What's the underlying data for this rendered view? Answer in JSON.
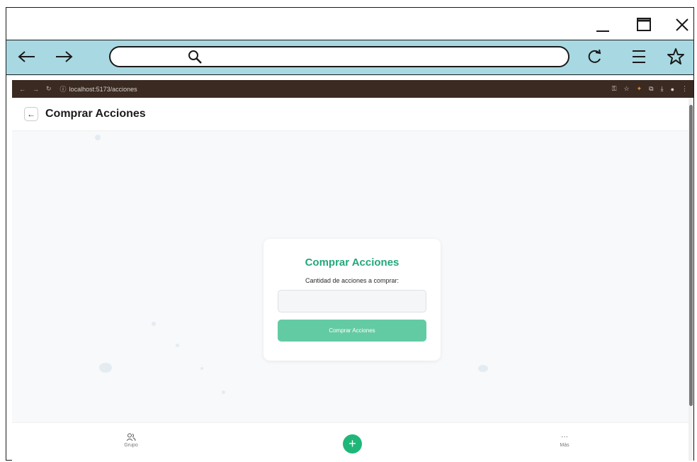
{
  "browser": {
    "url": "localhost:5173/acciones"
  },
  "header": {
    "title": "Comprar Acciones"
  },
  "form": {
    "title": "Comprar Acciones",
    "quantity_label": "Cantidad de acciones a comprar:",
    "quantity_value": "",
    "quantity_placeholder": "",
    "submit_label": "Comprar Acciones"
  },
  "bottom_nav": {
    "group_label": "Grupo",
    "add_symbol": "+",
    "more_symbol": "···",
    "more_label": "Más"
  },
  "colors": {
    "accent": "#23a77a",
    "button": "#63cba4",
    "fab": "#1fb779",
    "sketch_navbar": "#a8d8e2"
  },
  "icons": [
    "minimize-icon",
    "maximize-icon",
    "close-icon",
    "back-arrow-icon",
    "forward-arrow-icon",
    "search-icon",
    "reload-icon",
    "menu-icon",
    "star-icon",
    "users-icon",
    "plus-icon",
    "more-icon"
  ]
}
